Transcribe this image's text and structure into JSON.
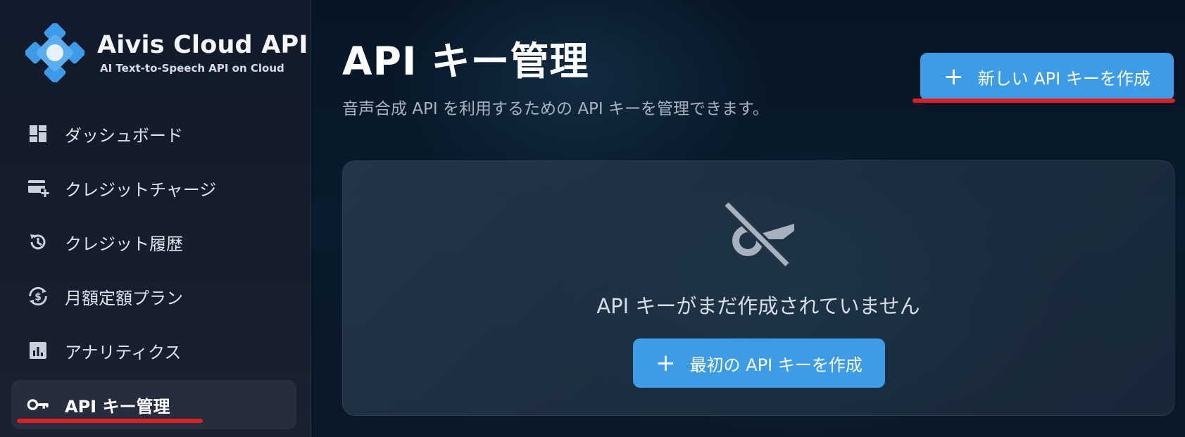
{
  "brand": {
    "name": "Aivis Cloud API",
    "tagline": "AI Text-to-Speech API on Cloud"
  },
  "sidebar": {
    "items": [
      {
        "label": "ダッシュボード",
        "icon": "dashboard-icon",
        "active": false
      },
      {
        "label": "クレジットチャージ",
        "icon": "credit-card-add-icon",
        "active": false
      },
      {
        "label": "クレジット履歴",
        "icon": "history-icon",
        "active": false
      },
      {
        "label": "月額定額プラン",
        "icon": "dollar-cycle-icon",
        "active": false
      },
      {
        "label": "アナリティクス",
        "icon": "analytics-icon",
        "active": false
      },
      {
        "label": "API キー管理",
        "icon": "key-icon",
        "active": true
      }
    ]
  },
  "page": {
    "title": "API キー管理",
    "subtitle": "音声合成 API を利用するための API キーを管理できます。",
    "create_button_label": "新しい API キーを作成"
  },
  "empty_state": {
    "icon": "key-off-icon",
    "message": "API キーがまだ作成されていません",
    "button_label": "最初の API キーを作成"
  },
  "colors": {
    "accent": "#3d9ce8",
    "annotation_red": "#e01e26",
    "sidebar_bg": "#121b2b",
    "main_bg": "#071626"
  }
}
